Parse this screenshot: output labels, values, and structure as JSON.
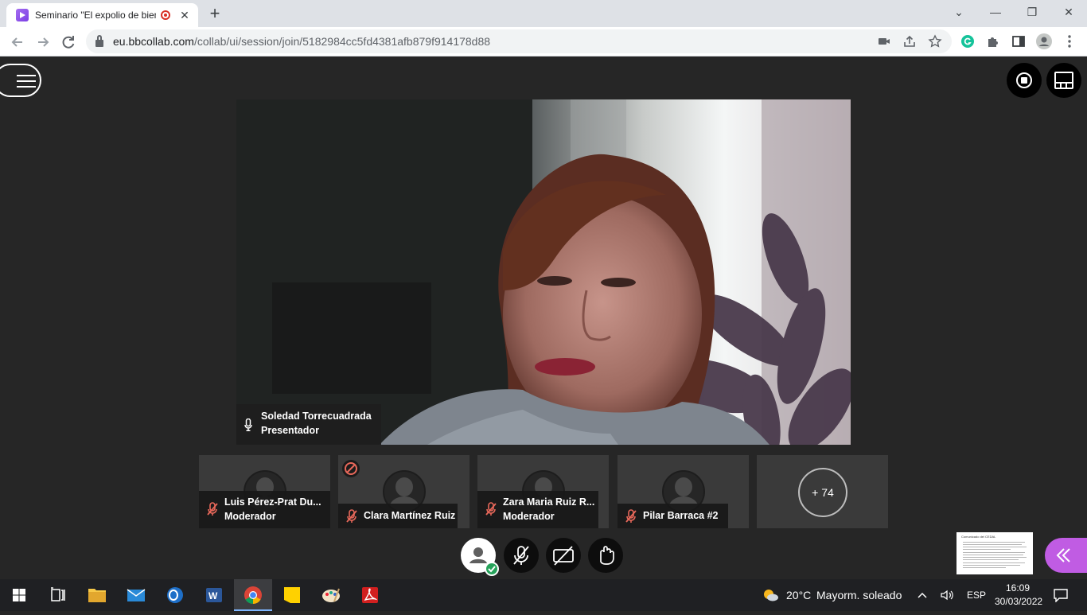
{
  "browser": {
    "tab_title": "Seminario \"El expolio de bienes culturales\"",
    "tab_close": "✕",
    "new_tab": "+",
    "url_host": "eu.bbcollab.com",
    "url_path": "/collab/ui/session/join/5182984cc5fd4381afb879f914178d88",
    "window_controls": {
      "dropdown": "⌄",
      "minimize": "—",
      "restore": "❐",
      "close": "✕"
    }
  },
  "session": {
    "presenter": {
      "name": "Soledad Torrecuadrada",
      "role": "Presentador"
    },
    "participants": [
      {
        "name": "Luis Pérez-Prat Du...",
        "role": "Moderador",
        "muted": true
      },
      {
        "name": "Clara Martínez Ruiz",
        "role": "",
        "muted": true,
        "blocked": true
      },
      {
        "name": "Zara Maria Ruiz R...",
        "role": "Moderador",
        "muted": true
      },
      {
        "name": "Pilar Barraca #2",
        "role": "",
        "muted": true
      }
    ],
    "more_participants": "+ 74",
    "shared_doc_title": "Comunicado del CEDAL"
  },
  "taskbar": {
    "weather_temp": "20°C",
    "weather_desc": "Mayorm. soleado",
    "language": "ESP",
    "time": "16:09",
    "date": "30/03/2022",
    "apps": [
      "start",
      "task-view",
      "file-explorer",
      "mail",
      "outlook",
      "word",
      "chrome",
      "sticky-notes",
      "paint",
      "acrobat"
    ]
  },
  "colors": {
    "accent_purple": "#c05ce3",
    "muted_red": "#e8685a",
    "status_green": "#26a35a",
    "session_bg": "#262626"
  }
}
